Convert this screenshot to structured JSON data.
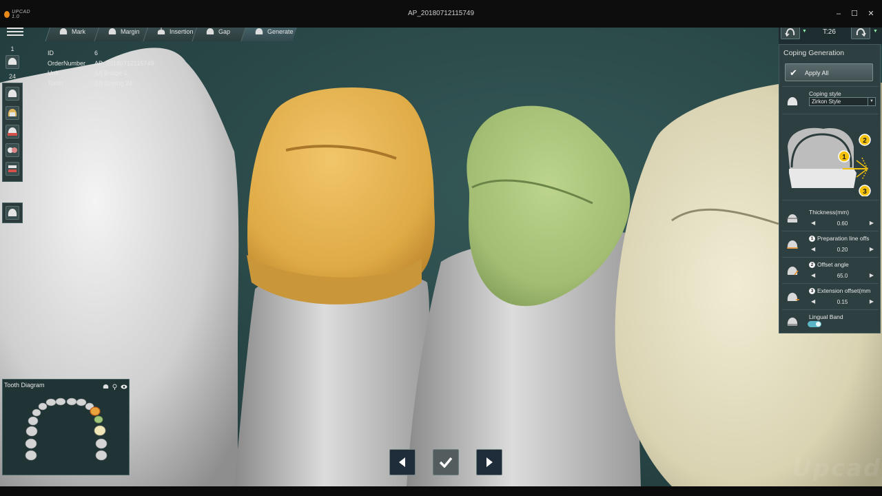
{
  "window": {
    "app_logo_text": "UPCAD 1.0",
    "title": "AP_20180712115749",
    "controls": {
      "minimize": "–",
      "maximize": "☐",
      "close": "✕"
    }
  },
  "tabs": [
    {
      "label": "Mark",
      "active": false
    },
    {
      "label": "Margin",
      "active": false
    },
    {
      "label": "Insertion",
      "active": false
    },
    {
      "label": "Gap",
      "active": false
    },
    {
      "label": "Generate",
      "active": true
    }
  ],
  "left_toolbar": {
    "upper_number": "1",
    "lower_number": "24"
  },
  "info": [
    {
      "key": "ID",
      "value": "6"
    },
    {
      "key": "OrderNumber",
      "value": "AP_20180712115749"
    },
    {
      "key": "Unit",
      "value": "[U] Bridge 1"
    },
    {
      "key": "Tooth",
      "value": "[U] Coping 24"
    }
  ],
  "tooth_diagram": {
    "title": "Tooth Diagram"
  },
  "right_panel": {
    "top_label": "T:26",
    "title": "Coping Generation",
    "apply_all": "Apply All",
    "coping_style_label": "Coping style",
    "coping_style_value": "Zirkon Style",
    "diagram_numbers": [
      "1",
      "2",
      "3"
    ],
    "params": [
      {
        "badge": "",
        "label": "Thickness(mm)",
        "value": "0.60"
      },
      {
        "badge": "1",
        "label": "Preparation line offs",
        "value": "0.20"
      },
      {
        "badge": "2",
        "label": "Offset angle",
        "value": "65.0"
      },
      {
        "badge": "3",
        "label": "Extension offset(mm",
        "value": "0.15"
      }
    ],
    "lingual_band_label": "Lingual Band",
    "lingual_band_on": true
  },
  "colors": {
    "viewport_bg": "#2a4848",
    "coping_gold": "#e3b04a",
    "coping_green": "#a9c27a",
    "crown_ivory": "#ddd7b8",
    "die_grey": "#c9c9c9",
    "accent_yellow": "#f4c20d"
  },
  "watermark": "Upcad"
}
